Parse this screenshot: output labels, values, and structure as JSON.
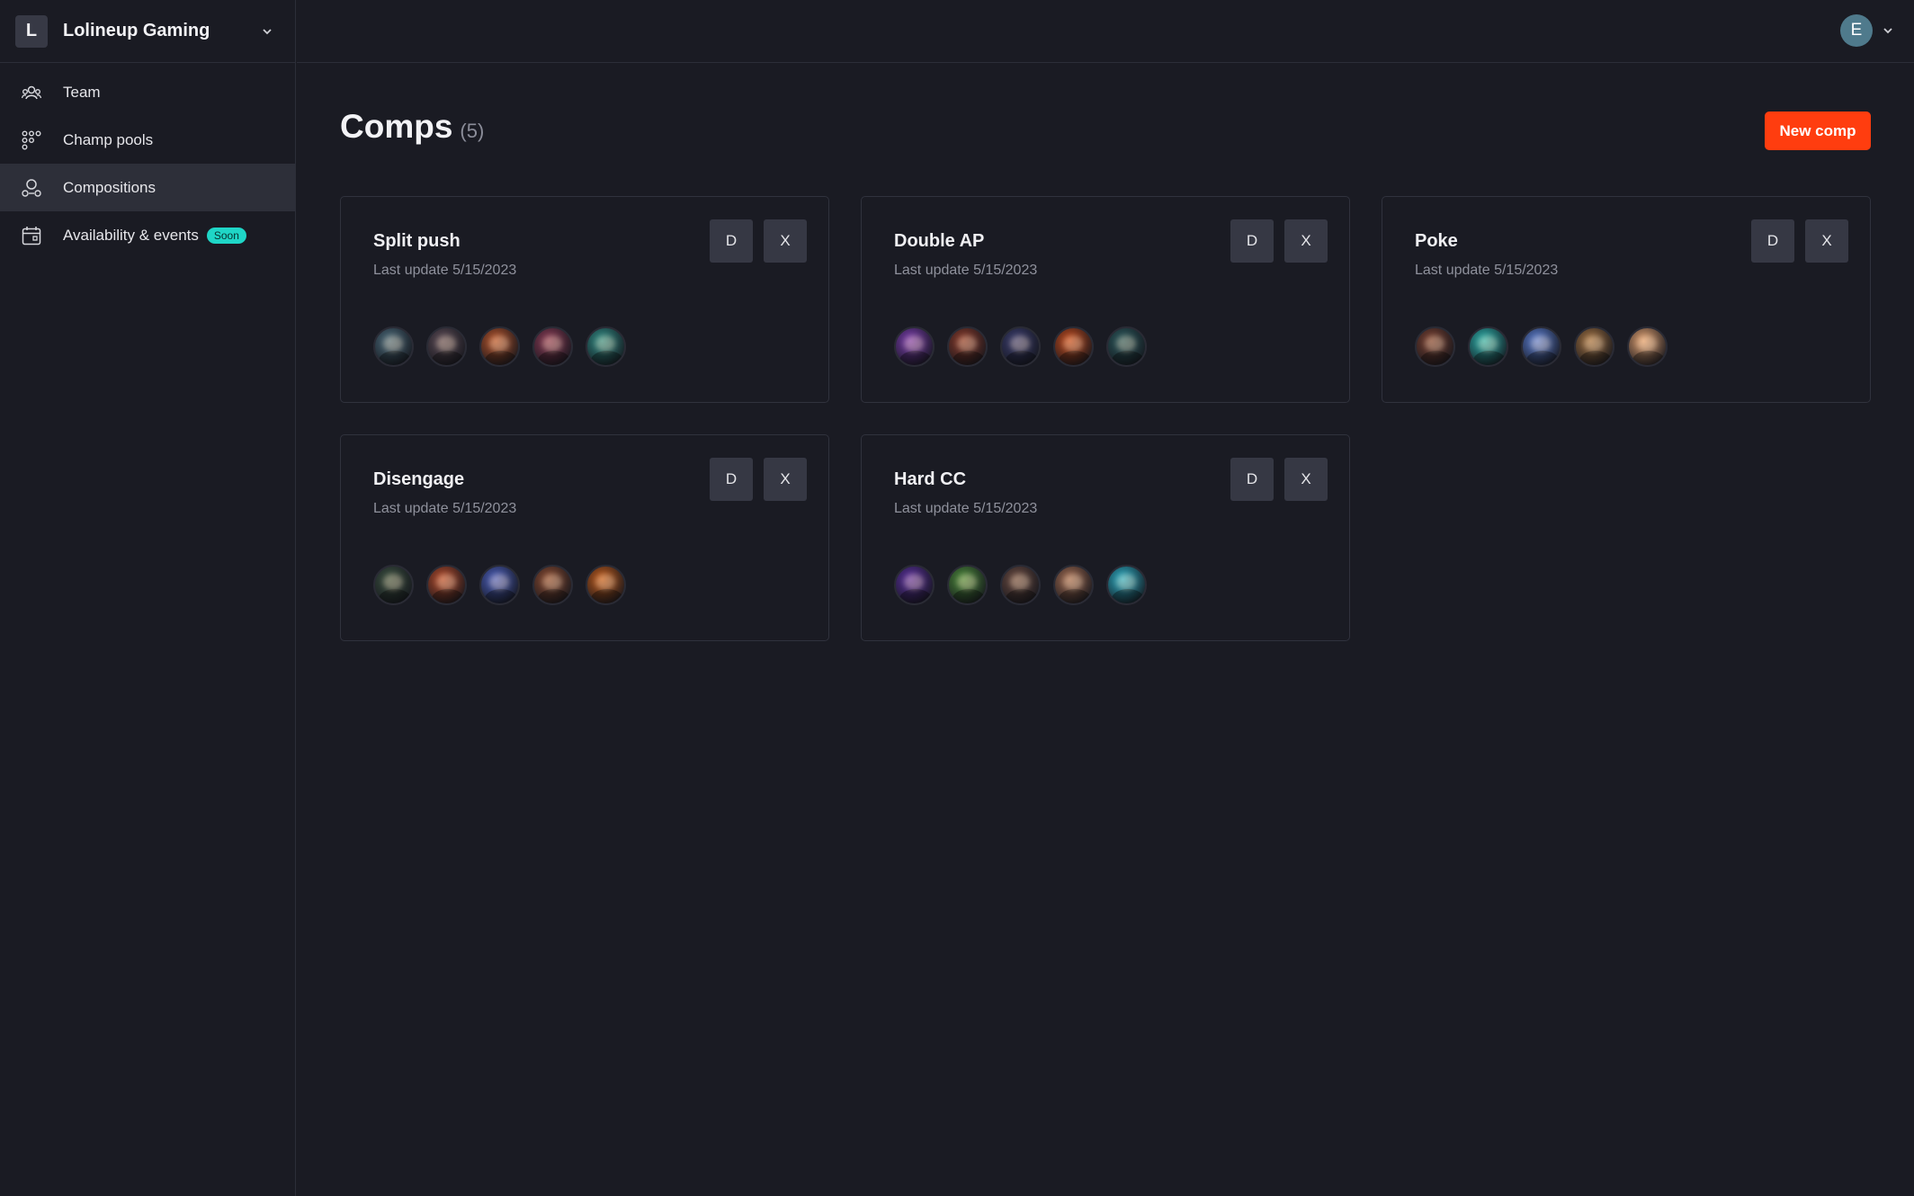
{
  "org": {
    "initial": "L",
    "name": "Lolineup Gaming"
  },
  "nav": [
    {
      "label": "Team",
      "icon": "team-icon",
      "active": false
    },
    {
      "label": "Champ pools",
      "icon": "grid-dots-icon",
      "active": false
    },
    {
      "label": "Compositions",
      "icon": "compositions-icon",
      "active": true
    },
    {
      "label": "Availability & events",
      "icon": "calendar-icon",
      "active": false,
      "badge": "Soon"
    }
  ],
  "user": {
    "initial": "E"
  },
  "page": {
    "title": "Comps",
    "count": "(5)",
    "new_button": "New comp"
  },
  "colors": {
    "accent": "#ff3d0f",
    "badge": "#1fd6c7",
    "background": "#1a1b23"
  },
  "comps": [
    {
      "title": "Split push",
      "subtitle": "Last update 5/15/2023",
      "dup": "D",
      "del": "X",
      "champs": [
        "#4a6b7c",
        "#5a4a55",
        "#b5532a",
        "#8a3a55",
        "#2f8f88"
      ]
    },
    {
      "title": "Double AP",
      "subtitle": "Last update 5/15/2023",
      "dup": "D",
      "del": "X",
      "champs": [
        "#7a3cb0",
        "#8a3a2a",
        "#3a3d70",
        "#c24a1c",
        "#2a5a5e"
      ]
    },
    {
      "title": "Poke",
      "subtitle": "Last update 5/15/2023",
      "dup": "D",
      "del": "X",
      "champs": [
        "#7a4030",
        "#2bb5b0",
        "#5a7fd6",
        "#a07040",
        "#e0a070"
      ]
    },
    {
      "title": "Disengage",
      "subtitle": "Last update 5/15/2023",
      "dup": "D",
      "del": "X",
      "champs": [
        "#3a5040",
        "#b54a2a",
        "#4a5fc0",
        "#8a4a30",
        "#c05a1a"
      ]
    },
    {
      "title": "Hard CC",
      "subtitle": "Last update 5/15/2023",
      "dup": "D",
      "del": "X",
      "champs": [
        "#5a2fa0",
        "#4a8a3a",
        "#6a4a40",
        "#a06a50",
        "#2ab0c8"
      ]
    }
  ]
}
